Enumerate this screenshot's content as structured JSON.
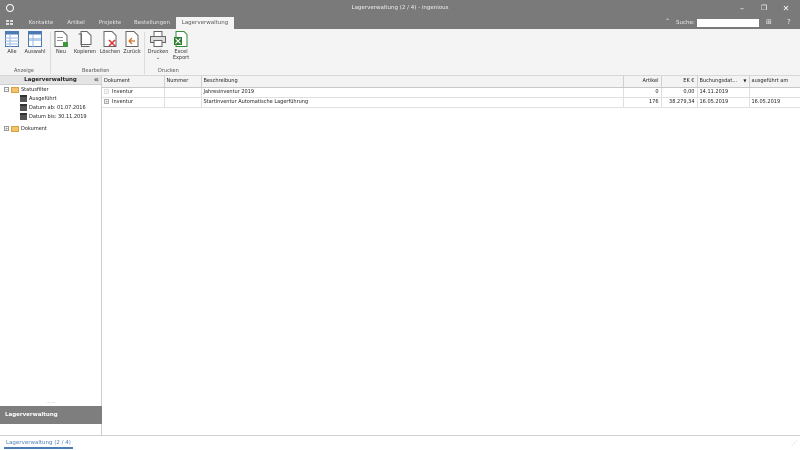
{
  "window": {
    "title": "Lagerverwaltung (2 / 4) - ingenious",
    "minimize_icon": "minimize-icon",
    "maximize_icon": "maximize-icon",
    "close_icon": "close-icon"
  },
  "menu": {
    "tabs": [
      {
        "label": "Kontakte"
      },
      {
        "label": "Artikel"
      },
      {
        "label": "Projekte"
      },
      {
        "label": "Bestellungen"
      },
      {
        "label": "Lagerverwaltung"
      }
    ],
    "active": "Lagerverwaltung",
    "search_label": "Suche:",
    "search_value": ""
  },
  "ribbon": {
    "buttons": {
      "alle": "Alle",
      "auswahl": "Auswahl",
      "neu": "Neu",
      "kopieren": "Kopieren",
      "loeschen": "Löschen",
      "zurueck": "Zurück",
      "drucken": "Drucken",
      "excel": "Excel Export"
    },
    "groups": {
      "anzeige": "Anzeige",
      "bearbeiten": "Bearbeiten",
      "drucken": "Drucken"
    }
  },
  "sidebar": {
    "header": "Lagerverwaltung",
    "tree": {
      "statusfilter": "Statusfilter",
      "ausgefuehrt": "Ausgeführt",
      "datum_ab": "Datum ab: 01.07.2016",
      "datum_bis": "Datum bis: 30.11.2019",
      "dokument": "Dokument"
    },
    "footer": "Lagerverwaltung"
  },
  "table": {
    "headers": {
      "dokument": "Dokument",
      "nummer": "Nummer",
      "beschreibung": "Beschreibung",
      "artikel": "Artikel",
      "ek": "EK €",
      "buchungsdatum": "Buchungsdat...",
      "ausgefuehrt_am": "ausgeführt am"
    },
    "rows": [
      {
        "dokument": "Inventur",
        "nummer": "",
        "beschreibung": "Jahresinventur 2019",
        "artikel": "0",
        "ek": "0,00",
        "buchungsdatum": "14.11.2019",
        "ausgefuehrt_am": ""
      },
      {
        "dokument": "Inventur",
        "nummer": "",
        "beschreibung": "Startinventur Automatische Lagerführung",
        "artikel": "176",
        "ek": "38.279,34",
        "buchungsdatum": "16.05.2019",
        "ausgefuehrt_am": "16.05.2019"
      }
    ]
  },
  "status": {
    "tab": "Lagerverwaltung (2 / 4)"
  },
  "colors": {
    "titlebar": "#7a7a7a",
    "accent": "#4a7bb5",
    "folder": "#f3c26a"
  }
}
